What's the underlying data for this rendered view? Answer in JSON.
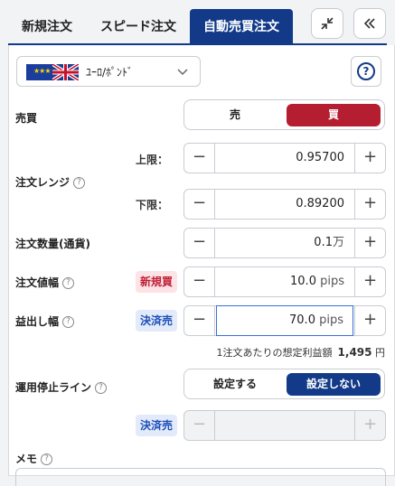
{
  "tabs": [
    {
      "label": "新規注文"
    },
    {
      "label": "スピード注文"
    },
    {
      "label": "自動売買注文"
    }
  ],
  "header_buttons": {
    "shrink_icon": "shrink-arrows-icon",
    "collapse_icon": "double-chevron-left-icon"
  },
  "currency": {
    "name": "ﾕｰﾛ/ﾎﾟﾝﾄﾞ",
    "help": "?"
  },
  "trade": {
    "label": "売買",
    "sell": "売",
    "buy": "買",
    "buy_color": "#b51d30"
  },
  "range": {
    "label": "注文レンジ",
    "upper_label": "上限：",
    "upper_value": "0.95700",
    "lower_label": "下限：",
    "lower_value": "0.89200"
  },
  "quantity": {
    "label": "注文数量(通貨)",
    "value": "0.1",
    "unit": "万"
  },
  "order_width": {
    "label": "注文値幅",
    "badge": "新規買",
    "value": "10.0",
    "unit": "pips"
  },
  "take_profit": {
    "label": "益出し幅",
    "badge": "決済売",
    "value": "70.0",
    "unit": "pips"
  },
  "profit_estimate": {
    "text": "1注文あたりの想定利益額",
    "value": "1,495",
    "unit": "円"
  },
  "stop_line": {
    "label": "運用停止ライン",
    "set": "設定する",
    "not_set": "設定しない",
    "badge": "決済売"
  },
  "memo": {
    "label": "メモ"
  },
  "symbols": {
    "minus": "−",
    "plus": "+",
    "help": "?"
  }
}
